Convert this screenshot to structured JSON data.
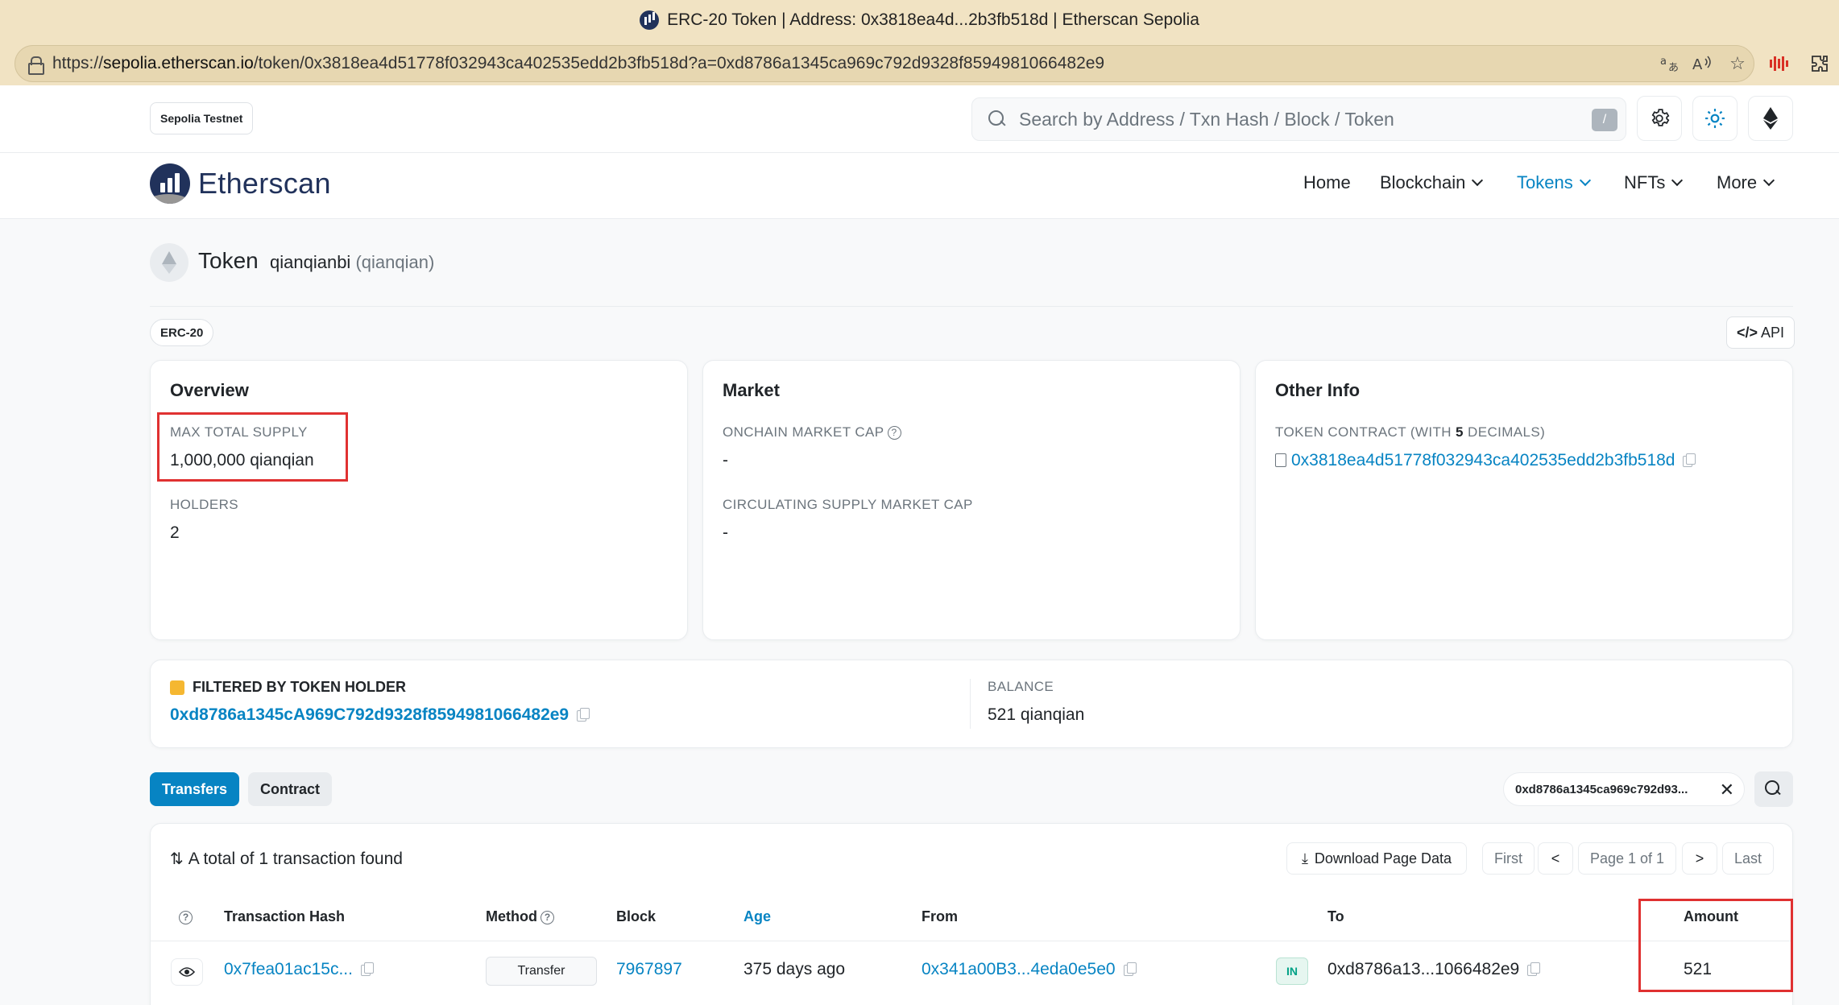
{
  "browser": {
    "window_title": "ERC-20 Token | Address: 0x3818ea4d...2b3fb518d | Etherscan Sepolia",
    "url_prefix": "https://",
    "url_host": "sepolia.etherscan.io",
    "url_path": "/token/0x3818ea4d51778f032943ca402535edd2b3fb518d?a=0xd8786a1345ca969c792d9328f8594981066482e9",
    "icons": [
      "translate-icon",
      "read-aloud-icon",
      "favorite-star-icon",
      "extension-icon",
      "puzzle-extensions-icon"
    ]
  },
  "header": {
    "network_badge": "Sepolia Testnet",
    "search_placeholder": "Search by Address / Txn Hash / Block / Token",
    "search_shortcut": "/"
  },
  "nav": {
    "logo_text": "Etherscan",
    "items": [
      {
        "label": "Home"
      },
      {
        "label": "Blockchain"
      },
      {
        "label": "Tokens"
      },
      {
        "label": "NFTs"
      },
      {
        "label": "More"
      }
    ],
    "active_color": "#0784c3"
  },
  "token": {
    "title": "Token",
    "name": "qianqianbi",
    "symbol": "(qianqian)",
    "standard_badge": "ERC-20",
    "api_label": "API"
  },
  "overview": {
    "title": "Overview",
    "max_supply_label": "MAX TOTAL SUPPLY",
    "max_supply_value": "1,000,000 qianqian",
    "holders_label": "HOLDERS",
    "holders_value": "2"
  },
  "market": {
    "title": "Market",
    "onchain_cap_label": "ONCHAIN MARKET CAP",
    "onchain_cap_value": "-",
    "circ_cap_label": "CIRCULATING SUPPLY MARKET CAP",
    "circ_cap_value": "-"
  },
  "other_info": {
    "title": "Other Info",
    "contract_label_prefix": "TOKEN CONTRACT (WITH ",
    "contract_decimals": "5",
    "contract_label_suffix": " DECIMALS)",
    "contract_address": "0x3818ea4d51778f032943ca402535edd2b3fb518d"
  },
  "filter": {
    "label": "FILTERED BY TOKEN HOLDER",
    "holder_address": "0xd8786a1345cA969C792d9328f8594981066482e9",
    "balance_label": "BALANCE",
    "balance_value": "521 qianqian"
  },
  "tabs": {
    "transfers": "Transfers",
    "contract": "Contract",
    "filter_pill": "0xd8786a1345ca969c792d93..."
  },
  "table": {
    "summary": "A total of 1 transaction found",
    "download_label": "Download Page Data",
    "pagination": {
      "first": "First",
      "prev": "<",
      "page": "Page 1 of 1",
      "next": ">",
      "last": "Last"
    },
    "headers": {
      "hash": "Transaction Hash",
      "method": "Method",
      "block": "Block",
      "age": "Age",
      "from": "From",
      "to": "To",
      "amount": "Amount"
    },
    "rows": [
      {
        "hash": "0x7fea01ac15c...",
        "method": "Transfer",
        "block": "7967897",
        "age": "375 days ago",
        "from": "0x341a00B3...4eda0e5e0",
        "direction": "IN",
        "to": "0xd8786a13...1066482e9",
        "amount": "521"
      }
    ]
  }
}
